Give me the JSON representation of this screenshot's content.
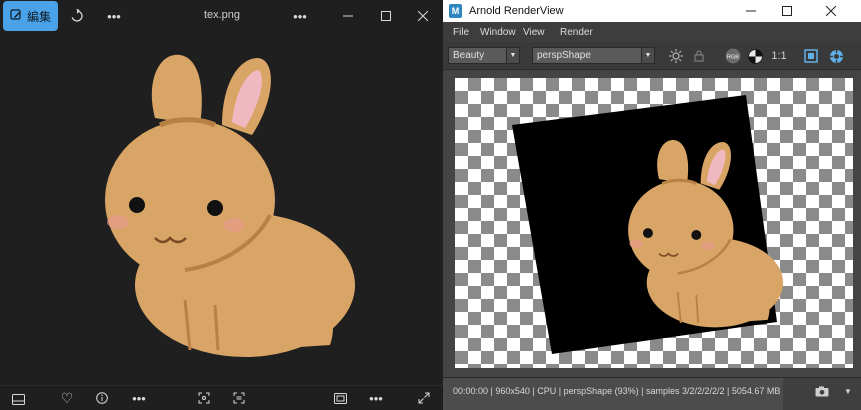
{
  "photos": {
    "edit_label": "編集",
    "file_name": "tex.png",
    "icons": [
      "edit-icon",
      "rotate-icon",
      "more-icon",
      "minimize-icon",
      "maximize-icon",
      "close-icon",
      "filmstrip-icon",
      "heart-icon",
      "info-icon",
      "crop-icon",
      "ocr-icon",
      "fit-icon",
      "expand-icon"
    ],
    "accent_color": "#4aa3e8"
  },
  "arnold": {
    "window_title": "Arnold RenderView",
    "menu": [
      "File",
      "Window",
      "View",
      "Render"
    ],
    "aov_value": "Beauty",
    "camera_value": "perspShape",
    "ratio_label": "1:1",
    "rgb_label": "RGB",
    "status": "00:00:00 | 960x540 | CPU | perspShape (93%) | samples 3/2/2/2/2/2 | 5054.67 MB"
  }
}
